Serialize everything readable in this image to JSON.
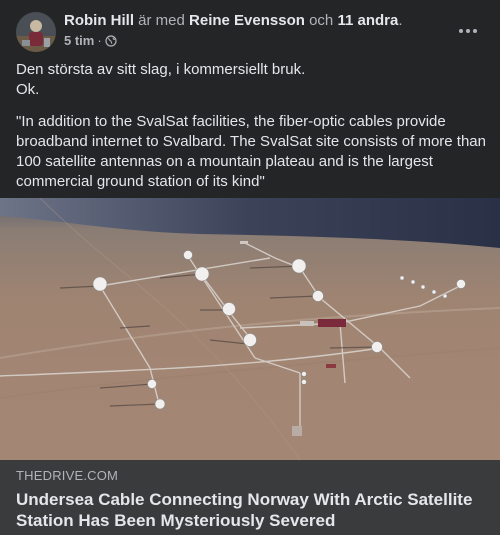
{
  "post": {
    "author": "Robin Hill",
    "with_text": "är med",
    "tagged_person": "Reine Evensson",
    "and_text": "och",
    "others": "11 andra",
    "period": ".",
    "timestamp": "5 tim",
    "separator": "·",
    "privacy_icon": "globe-icon",
    "more_icon": "more-options-icon",
    "lines": [
      "Den största av sitt slag, i kommersiellt bruk.",
      "Ok.",
      "\"In addition to the SvalSat facilities, the fiber-optic cables provide broadband internet to Svalbard. The SvalSat site consists of more than 100 satellite antennas on a mountain plateau and is the largest commercial ground station of its kind\""
    ]
  },
  "link_preview": {
    "domain": "THEDRIVE.COM",
    "title": "Undersea Cable Connecting Norway With Arctic Satellite Station Has Been Mysteriously Severed"
  },
  "colors": {
    "card_bg": "#242526",
    "link_bg": "#3a3b3c",
    "text_primary": "#e4e6eb",
    "text_secondary": "#b0b3b8"
  }
}
